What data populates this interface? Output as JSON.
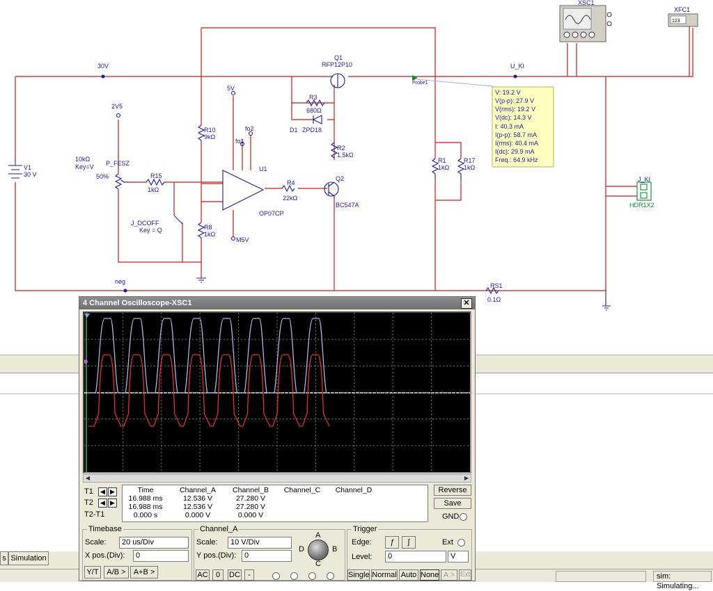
{
  "schematic": {
    "labels": {
      "xsc1": "XSC1",
      "xfc1": "XFC1",
      "xfc1_display": "123",
      "q1": "Q1",
      "q1_part": "RFP12P10",
      "v30": "30V",
      "u_ki": "U_KI",
      "probe": "Probe1",
      "v5": "5V",
      "v2v5": "2V5",
      "r3": "R3",
      "r3_val": "680Ω",
      "d1": "D1",
      "d1_part": "ZPD18",
      "r10": "R10",
      "r10_val": "9kΩ",
      "fo2": "fo2",
      "fo1": "fo1",
      "r2": "R2",
      "r2_val": "1.5kΩ",
      "pot_val": "10kΩ",
      "pot_key": "Key=V",
      "pot_name": "P_FESZ",
      "pot_pct": "50%",
      "r15": "R15",
      "r15_val": "1kΩ",
      "u1": "U1",
      "u1_part": "OP07CP",
      "r4": "R4",
      "r4_val": "22kΩ",
      "q2": "Q2",
      "q2_part": "BC547A",
      "v1": "V1",
      "v1_val": "30 V",
      "j_dcoff": "J_DCOFF",
      "j_dcoff_key": "Key = Q",
      "r8": "R8",
      "r8_val": "1kΩ",
      "m5v": "M5V",
      "r1": "R1",
      "r1_val": "1kΩ",
      "r17": "R17",
      "r17_val": "1kΩ",
      "j_ki": "J_KI",
      "hdr": "HDR1X2",
      "neg": "neg",
      "rs1": "RS1",
      "rs1_val": "0.1Ω"
    },
    "probe_readout": [
      "V: 19.2 V",
      "V(p-p): 27.9 V",
      "V(rms): 19.2 V",
      "V(dc): 14.3 V",
      "I: 40.3 mA",
      "I(p-p): 58.7 mA",
      "I(rms): 40.4 mA",
      "I(dc): 29.9 mA",
      "Freq.: 64.9 kHz"
    ]
  },
  "scope": {
    "title": "4 Channel Oscilloscope-XSC1",
    "close": "✕",
    "traces": {
      "channel_a_color": "#e23030",
      "channel_b_color": "#a8b4e8",
      "ground_color": "#ffffff",
      "grid_color": "#7a7a7a",
      "cycles_shown": 8
    },
    "cursors": {
      "t1": "T1",
      "t2": "T2",
      "t2t1": "T2-T1"
    },
    "readout": {
      "headers": [
        "Time",
        "Channel_A",
        "Channel_B",
        "Channel_C",
        "Channel_D"
      ],
      "rows": [
        [
          "16.988 ms",
          "12.536 V",
          "27.280 V",
          "",
          ""
        ],
        [
          "16.988 ms",
          "12.536 V",
          "27.280 V",
          "",
          ""
        ],
        [
          "0.000 s",
          "0.000 V",
          "0.000 V",
          "",
          ""
        ]
      ]
    },
    "buttons": {
      "reverse": "Reverse",
      "save": "Save",
      "gnd": "GND"
    },
    "timebase": {
      "title": "Timebase",
      "scale_label": "Scale:",
      "scale": "20 us/Div",
      "xpos_label": "X pos.(Div):",
      "xpos": "0",
      "modes": [
        "Y/T",
        "A/B >",
        "A+B >"
      ]
    },
    "channel": {
      "title": "Channel_A",
      "scale_label": "Scale:",
      "scale": "10  V/Div",
      "ypos_label": "Y pos.(Div):",
      "ypos": "0",
      "coupling": [
        "AC",
        "0",
        "DC",
        "-"
      ],
      "knob_labels": [
        "A",
        "B",
        "C",
        "D"
      ]
    },
    "trigger": {
      "title": "Trigger",
      "edge_label": "Edge:",
      "ext_label": "Ext",
      "level_label": "Level:",
      "level": "0",
      "level_unit": "V",
      "modes": [
        "Single",
        "Normal",
        "Auto",
        "None",
        "A >",
        "Ext"
      ]
    }
  },
  "bottom": {
    "tabs": [
      "s",
      "Simulation"
    ],
    "status": "sim: Simulating..."
  }
}
